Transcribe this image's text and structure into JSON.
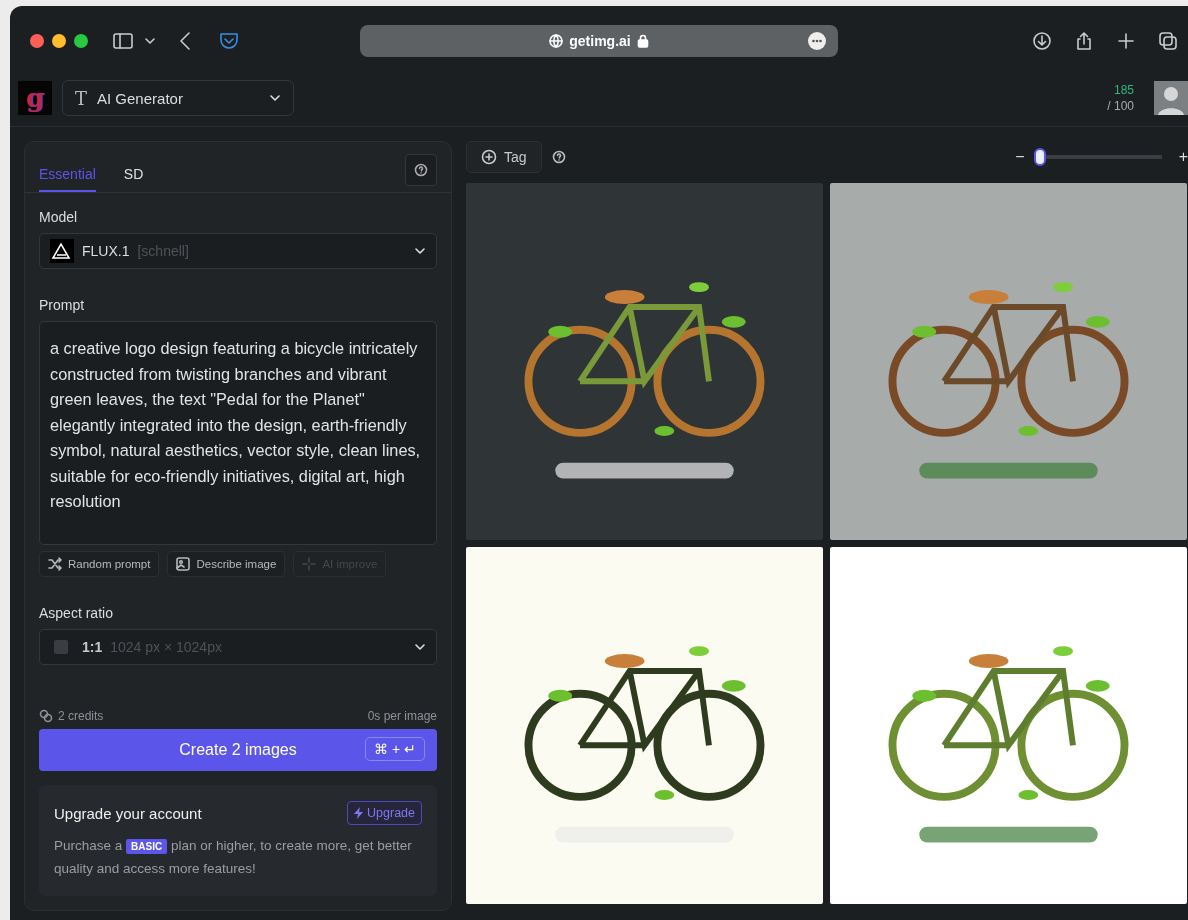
{
  "browser": {
    "url": "getimg.ai"
  },
  "app_bar": {
    "logo": "g",
    "tool_icon": "T",
    "tool": "AI Generator",
    "credits_used": "185",
    "credits_total": "/ 100"
  },
  "settings": {
    "tabs": [
      {
        "label": "Essential",
        "selected": true
      },
      {
        "label": "SD",
        "selected": false
      }
    ],
    "model_label": "Model",
    "model": {
      "name": "FLUX.1",
      "variant": "[schnell]"
    },
    "prompt_label": "Prompt",
    "prompt": "a creative logo design featuring a bicycle intricately constructed from twisting branches and vibrant green leaves, the text \"Pedal for the Planet\" elegantly integrated into the design, earth-friendly symbol, natural aesthetics, vector style, clean lines, suitable for eco-friendly initiatives, digital art, high resolution",
    "prompt_actions": [
      {
        "label": "Random prompt",
        "kind": "shuffle",
        "disabled": false
      },
      {
        "label": "Describe image",
        "kind": "describe",
        "disabled": false
      },
      {
        "label": "AI improve",
        "kind": "sparkle",
        "disabled": true
      }
    ],
    "aspect_label": "Aspect ratio",
    "aspect": {
      "ratio": "1:1",
      "size": "1024 px × 1024px"
    },
    "credits": "2 credits",
    "speed": "0s per image",
    "create": {
      "label": "Create 2 images",
      "shortcut": "⌘ + ↵"
    },
    "upgrade": {
      "title": "Upgrade your account",
      "button": "Upgrade",
      "text": "Purchase a **BASIC** plan or higher, to create more, get better quality and access more features!"
    }
  },
  "gallery": {
    "tag_button": "Tag",
    "zoom": {
      "minus": "−",
      "plus": "+",
      "level": 0.03
    }
  }
}
